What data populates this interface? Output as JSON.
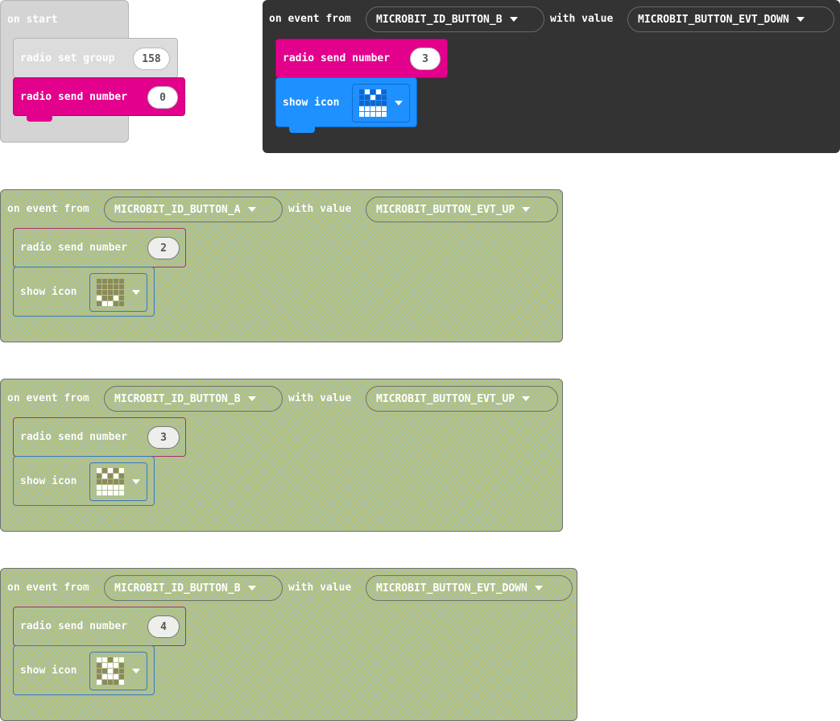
{
  "on_start": {
    "label": "on start",
    "set_group_label": "radio set group",
    "group_value": "158",
    "send_label": "radio send number",
    "send_value": "0"
  },
  "events": [
    {
      "title": "on event from",
      "source": "MICROBIT_ID_BUTTON_B",
      "with_value_label": "with value",
      "value": "MICROBIT_BUTTON_EVT_DOWN",
      "send_label": "radio send number",
      "send_value": "3",
      "show_icon_label": "show icon",
      "icon": [
        [
          0,
          1,
          0,
          1,
          0
        ],
        [
          0,
          0,
          1,
          0,
          0
        ],
        [
          0,
          0,
          0,
          0,
          0
        ],
        [
          1,
          1,
          1,
          1,
          1
        ],
        [
          1,
          1,
          1,
          1,
          1
        ]
      ],
      "enabled": true
    },
    {
      "title": "on event from",
      "source": "MICROBIT_ID_BUTTON_A",
      "with_value_label": "with value",
      "value": "MICROBIT_BUTTON_EVT_UP",
      "send_label": "radio send number",
      "send_value": "2",
      "show_icon_label": "show icon",
      "icon": [
        [
          0,
          0,
          0,
          0,
          0
        ],
        [
          0,
          0,
          0,
          0,
          0
        ],
        [
          0,
          0,
          0,
          0,
          0
        ],
        [
          1,
          0,
          0,
          1,
          0
        ],
        [
          0,
          1,
          1,
          0,
          0
        ]
      ],
      "enabled": false
    },
    {
      "title": "on event from",
      "source": "MICROBIT_ID_BUTTON_B",
      "with_value_label": "with value",
      "value": "MICROBIT_BUTTON_EVT_UP",
      "send_label": "radio send number",
      "send_value": "3",
      "show_icon_label": "show icon",
      "icon": [
        [
          1,
          0,
          1,
          0,
          1
        ],
        [
          0,
          1,
          0,
          1,
          0
        ],
        [
          0,
          0,
          0,
          0,
          0
        ],
        [
          1,
          1,
          1,
          1,
          1
        ],
        [
          1,
          1,
          1,
          1,
          1
        ]
      ],
      "enabled": false
    },
    {
      "title": "on event from",
      "source": "MICROBIT_ID_BUTTON_B",
      "with_value_label": "with value",
      "value": "MICROBIT_BUTTON_EVT_DOWN",
      "send_label": "radio send number",
      "send_value": "4",
      "show_icon_label": "show icon",
      "icon": [
        [
          1,
          1,
          0,
          1,
          1
        ],
        [
          0,
          1,
          1,
          1,
          0
        ],
        [
          0,
          0,
          1,
          0,
          0
        ],
        [
          0,
          1,
          1,
          1,
          0
        ],
        [
          1,
          0,
          0,
          0,
          1
        ]
      ],
      "enabled": false
    }
  ]
}
